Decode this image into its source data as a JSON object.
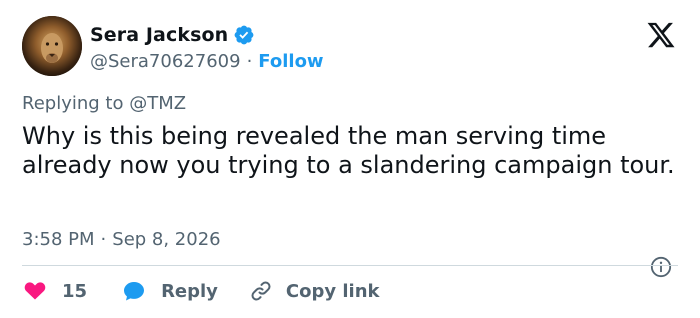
{
  "author": {
    "display_name": "Sera Jackson",
    "handle": "@Sera70627609",
    "separator": "·",
    "follow_label": "Follow",
    "avatar_icon": "lion-avatar",
    "verified_icon": "verified-badge-icon"
  },
  "reply_context": {
    "prefix": "Replying to",
    "mention": "@TMZ"
  },
  "tweet": {
    "text": "Why is this being revealed the man serving time already now you trying to a slandering campaign tour.",
    "time": "3:58 PM",
    "separator": "·",
    "date": "Sep 8, 2026"
  },
  "actions": {
    "like_count": "15",
    "reply_label": "Reply",
    "copy_link_label": "Copy link"
  },
  "colors": {
    "accent": "#1d9bf0",
    "like": "#f91880",
    "text": "#0f1419",
    "muted": "#536471",
    "divider": "#cfd9de"
  }
}
